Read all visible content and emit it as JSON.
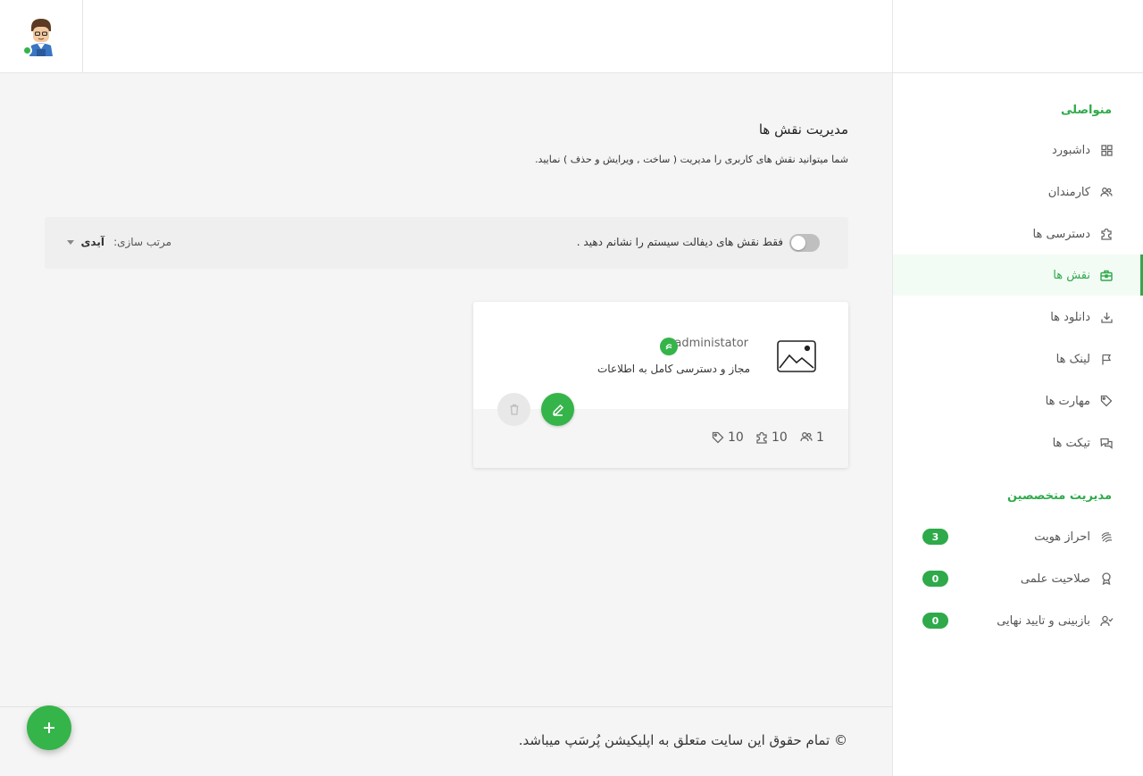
{
  "colors": {
    "accent": "#2eaa4a",
    "badge": "#35b44a"
  },
  "sidebar": {
    "section_main": "منواصلی",
    "items": [
      {
        "label": "داشبورد",
        "icon": "dashboard-icon"
      },
      {
        "label": "کارمندان",
        "icon": "users-icon"
      },
      {
        "label": "دسترسی ها",
        "icon": "puzzle-icon"
      },
      {
        "label": "نقش ها",
        "icon": "briefcase-icon",
        "active": true
      },
      {
        "label": "دانلود ها",
        "icon": "download-icon"
      },
      {
        "label": "لینک ها",
        "icon": "flag-icon"
      },
      {
        "label": "مهارت ها",
        "icon": "tag-icon"
      },
      {
        "label": "تیکت ها",
        "icon": "messages-icon"
      }
    ],
    "section_experts": "مدیریت متخصصین",
    "expert_items": [
      {
        "label": "احراز هویت",
        "icon": "fingerprint-icon",
        "badge": "3"
      },
      {
        "label": "صلاحیت علمی",
        "icon": "award-icon",
        "badge": "0"
      },
      {
        "label": "بازبینی و تایید نهایی",
        "icon": "user-check-icon",
        "badge": "0"
      }
    ]
  },
  "main": {
    "title": "مدیریت نقش ها",
    "description": "شما میتوانید نقش های کاربری را مدیریت ( ساخت , ویرایش و حذف ) نمایید.",
    "filter": {
      "toggle_label": "فقط نقش های دیفالت سیستم را نشانم دهید .",
      "sort_label": "مرتب سازی:",
      "sort_value": "آیدی"
    },
    "card": {
      "name": "administator",
      "description": "مجاز و دسترسی کامل به اطلاعات",
      "stats": {
        "tags": "10",
        "permissions": "10",
        "users": "1"
      }
    }
  },
  "footer": {
    "copyright": "© تمام حقوق این سایت متعلق به اپلیکیشن پُرسَپ میباشد."
  }
}
